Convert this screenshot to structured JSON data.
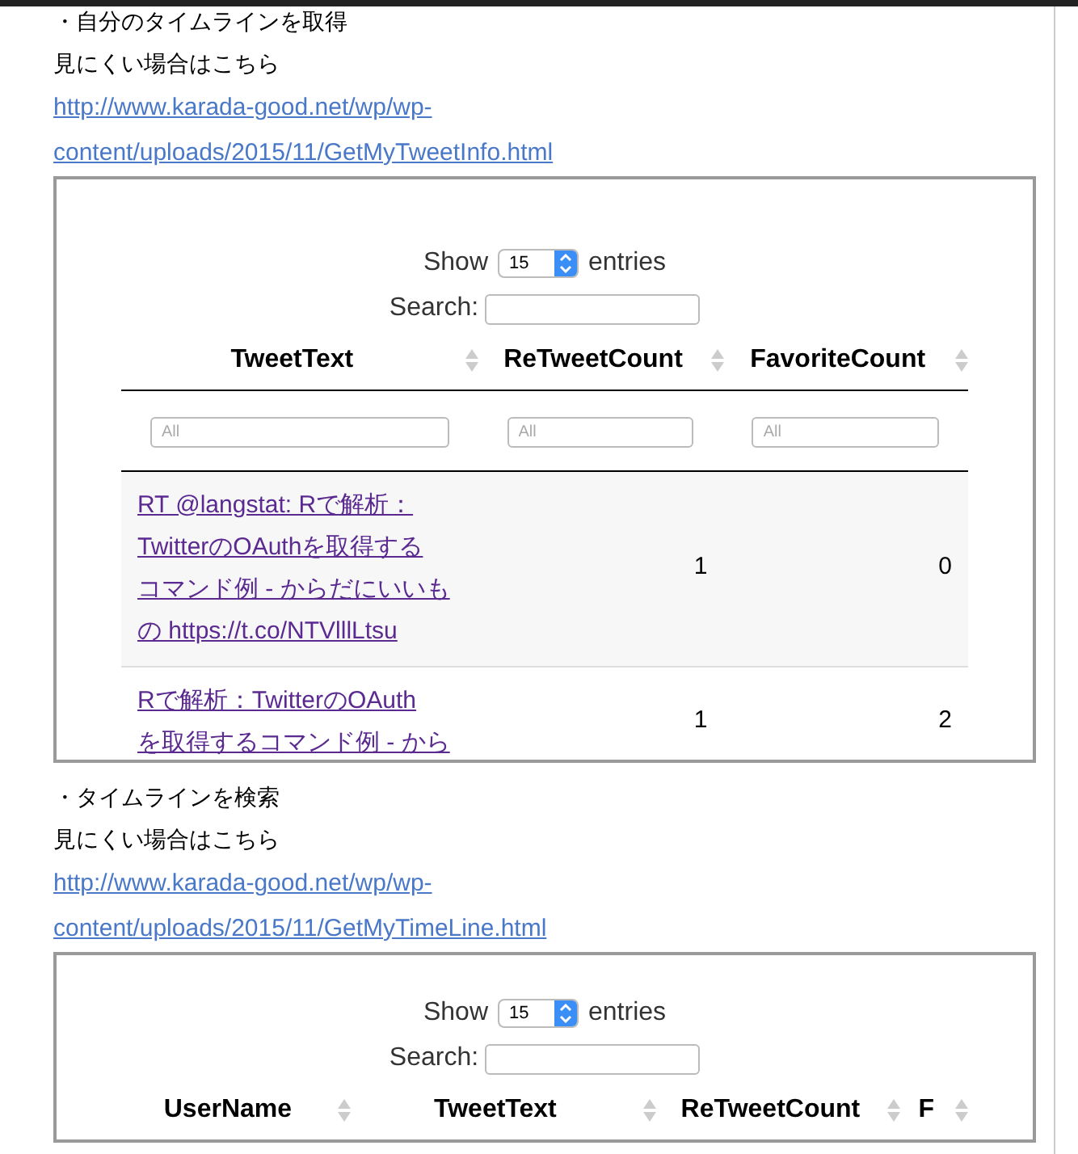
{
  "sections": [
    {
      "heading": "・自分のタイムラインを取得",
      "note": "見にくい場合はこちら",
      "link": [
        "http://www.karada-good.net/wp/wp-",
        "content/uploads/2015/11/GetMyTweetInfo.html"
      ],
      "embed": {
        "show_label": "Show",
        "page_size": "15",
        "entries_label": "entries",
        "search_label": "Search:",
        "columns": [
          {
            "label": "TweetText"
          },
          {
            "label": "ReTweetCount"
          },
          {
            "label": "FavoriteCount"
          }
        ],
        "filters": [
          {
            "placeholder": "All"
          },
          {
            "placeholder": "All"
          },
          {
            "placeholder": "All"
          }
        ],
        "rows": [
          {
            "cells": [
              [
                "RT @langstat: Rで解析：",
                "TwitterのOAuthを取得する",
                "コマンド例 - からだにいいも",
                "の https://t.co/NTVlllLtsu"
              ],
              "1",
              "0"
            ]
          },
          {
            "cells": [
              [
                "Rで解析：TwitterのOAuth",
                "を取得するコマンド例 - から"
              ],
              "1",
              "2"
            ]
          }
        ]
      }
    },
    {
      "heading": "・タイムラインを検索",
      "note": "見にくい場合はこちら",
      "link": [
        "http://www.karada-good.net/wp/wp-",
        "content/uploads/2015/11/GetMyTimeLine.html"
      ],
      "embed": {
        "show_label": "Show",
        "page_size": "15",
        "entries_label": "entries",
        "search_label": "Search:",
        "columns": [
          {
            "label": "UserName"
          },
          {
            "label": "TweetText"
          },
          {
            "label": "ReTweetCount"
          },
          {
            "label": "F"
          }
        ]
      }
    }
  ]
}
